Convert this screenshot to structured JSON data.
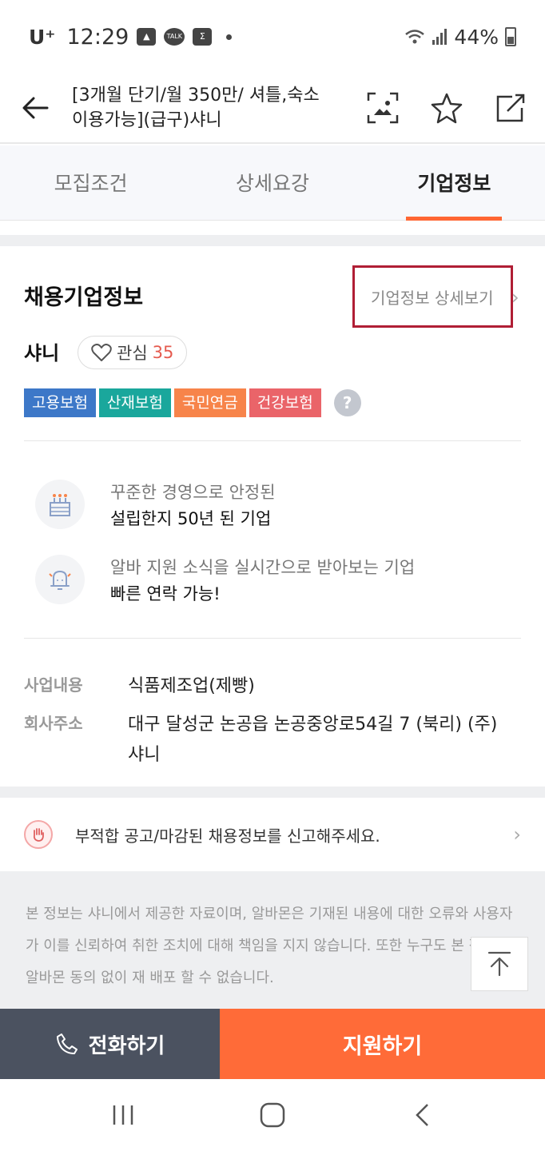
{
  "status_bar": {
    "carrier": "U⁺",
    "time": "12:29",
    "talk_label": "TALK",
    "battery": "44%"
  },
  "header": {
    "title": "[3개월 단기/월 350만/ 셔틀,숙소이용가능](급구)샤니"
  },
  "tabs": [
    {
      "label": "모집조건"
    },
    {
      "label": "상세요강"
    },
    {
      "label": "기업정보"
    }
  ],
  "company": {
    "section_title": "채용기업정보",
    "detail_link": "기업정보 상세보기",
    "name": "샤니",
    "fav_label": "관심",
    "fav_count": "35",
    "insurance": [
      {
        "label": "고용보험",
        "color": "#3d78c8"
      },
      {
        "label": "산재보험",
        "color": "#1aa79c"
      },
      {
        "label": "국민연금",
        "color": "#f7844a"
      },
      {
        "label": "건강보험",
        "color": "#ea6469"
      }
    ],
    "help_label": "?",
    "features": [
      {
        "icon": "cake-icon",
        "sub": "꾸준한 경영으로 안정된",
        "main": "설립한지 50년 된 기업"
      },
      {
        "icon": "bell-icon",
        "sub": "알바 지원 소식을 실시간으로 받아보는 기업",
        "main": "빠른 연락 가능!"
      }
    ],
    "business_label": "사업내용",
    "business_value": "식품제조업(제빵)",
    "address_label": "회사주소",
    "address_value": "대구 달성군 논공읍 논공중앙로54길 7 (북리) (주)샤니"
  },
  "report": {
    "text": "부적합 공고/마감된 채용정보를 신고해주세요."
  },
  "notice": {
    "text": "본 정보는 샤니에서 제공한 자료이며, 알바몬은 기재된 내용에 대한 오류와 사용자가 이를 신뢰하여 취한 조치에 대해 책임을 지지 않습니다. 또한 누구도 본 정보를 알바몬 동의 없이 재 배포 할 수 없습니다."
  },
  "cta": {
    "call_label": "전화하기",
    "apply_label": "지원하기"
  }
}
